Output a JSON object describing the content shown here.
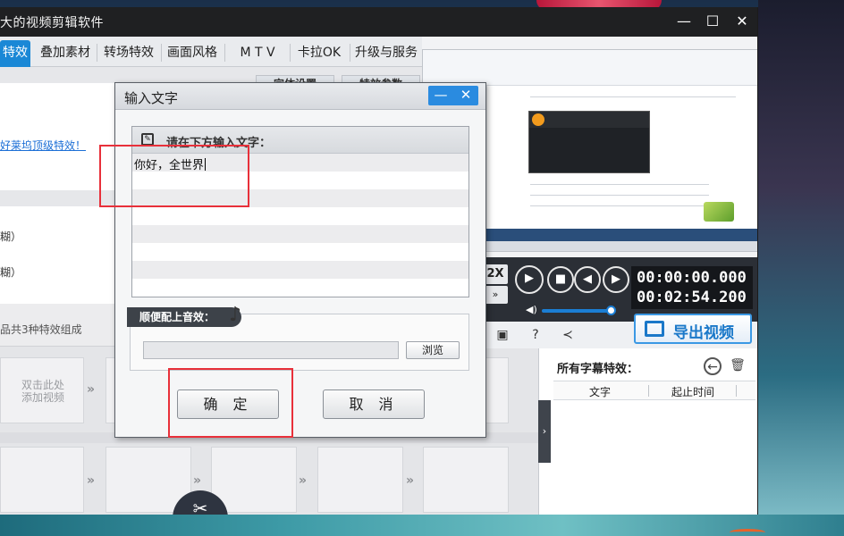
{
  "app": {
    "title": "大的视频剪辑软件",
    "window_controls": {
      "minimize": "—",
      "maximize": "☐",
      "close": "✕"
    }
  },
  "tabs": [
    {
      "label": "特效",
      "active": true
    },
    {
      "label": "叠加素材",
      "active": false
    },
    {
      "label": "转场特效",
      "active": false
    },
    {
      "label": "画面风格",
      "active": false
    },
    {
      "label": "M T V",
      "active": false
    },
    {
      "label": "卡拉OK",
      "active": false
    },
    {
      "label": "升级与服务",
      "active": false
    }
  ],
  "sub_tabs": [
    "字体设置",
    "特效参数"
  ],
  "left_panel": {
    "link_text": "好莱坞顶级特效！",
    "item1": "糊）",
    "item2": "糊）",
    "strip_hint": "品共3种特效组成"
  },
  "timeline": {
    "slot_add_text_line1": "双击此处",
    "slot_add_text_line2": "添加视频",
    "arrow_glyph": "»",
    "scissors_icon": "✂"
  },
  "player": {
    "speed_label": "2X",
    "speed_label2": "»",
    "time_current": "00:00:00.000",
    "time_total": "00:02:54.200",
    "volume_percent": 95
  },
  "export": {
    "label": "导出视频"
  },
  "subtitles": {
    "title": "所有字幕特效：",
    "col_text": "文字",
    "col_time": "起止时间"
  },
  "dialog": {
    "title": "输入文字",
    "min_glyph": "—",
    "close_glyph": "✕",
    "prompt": "请在下方输入文字：",
    "entered_text": "你好，全世界",
    "sound_label": "顺便配上音效：",
    "music_icon": "♪",
    "browse_label": "浏览",
    "ok_label": "确 定",
    "cancel_label": "取 消"
  },
  "colors": {
    "accent": "#1a88d6",
    "annotation": "#e8303a",
    "titlebar": "#1f2022"
  }
}
